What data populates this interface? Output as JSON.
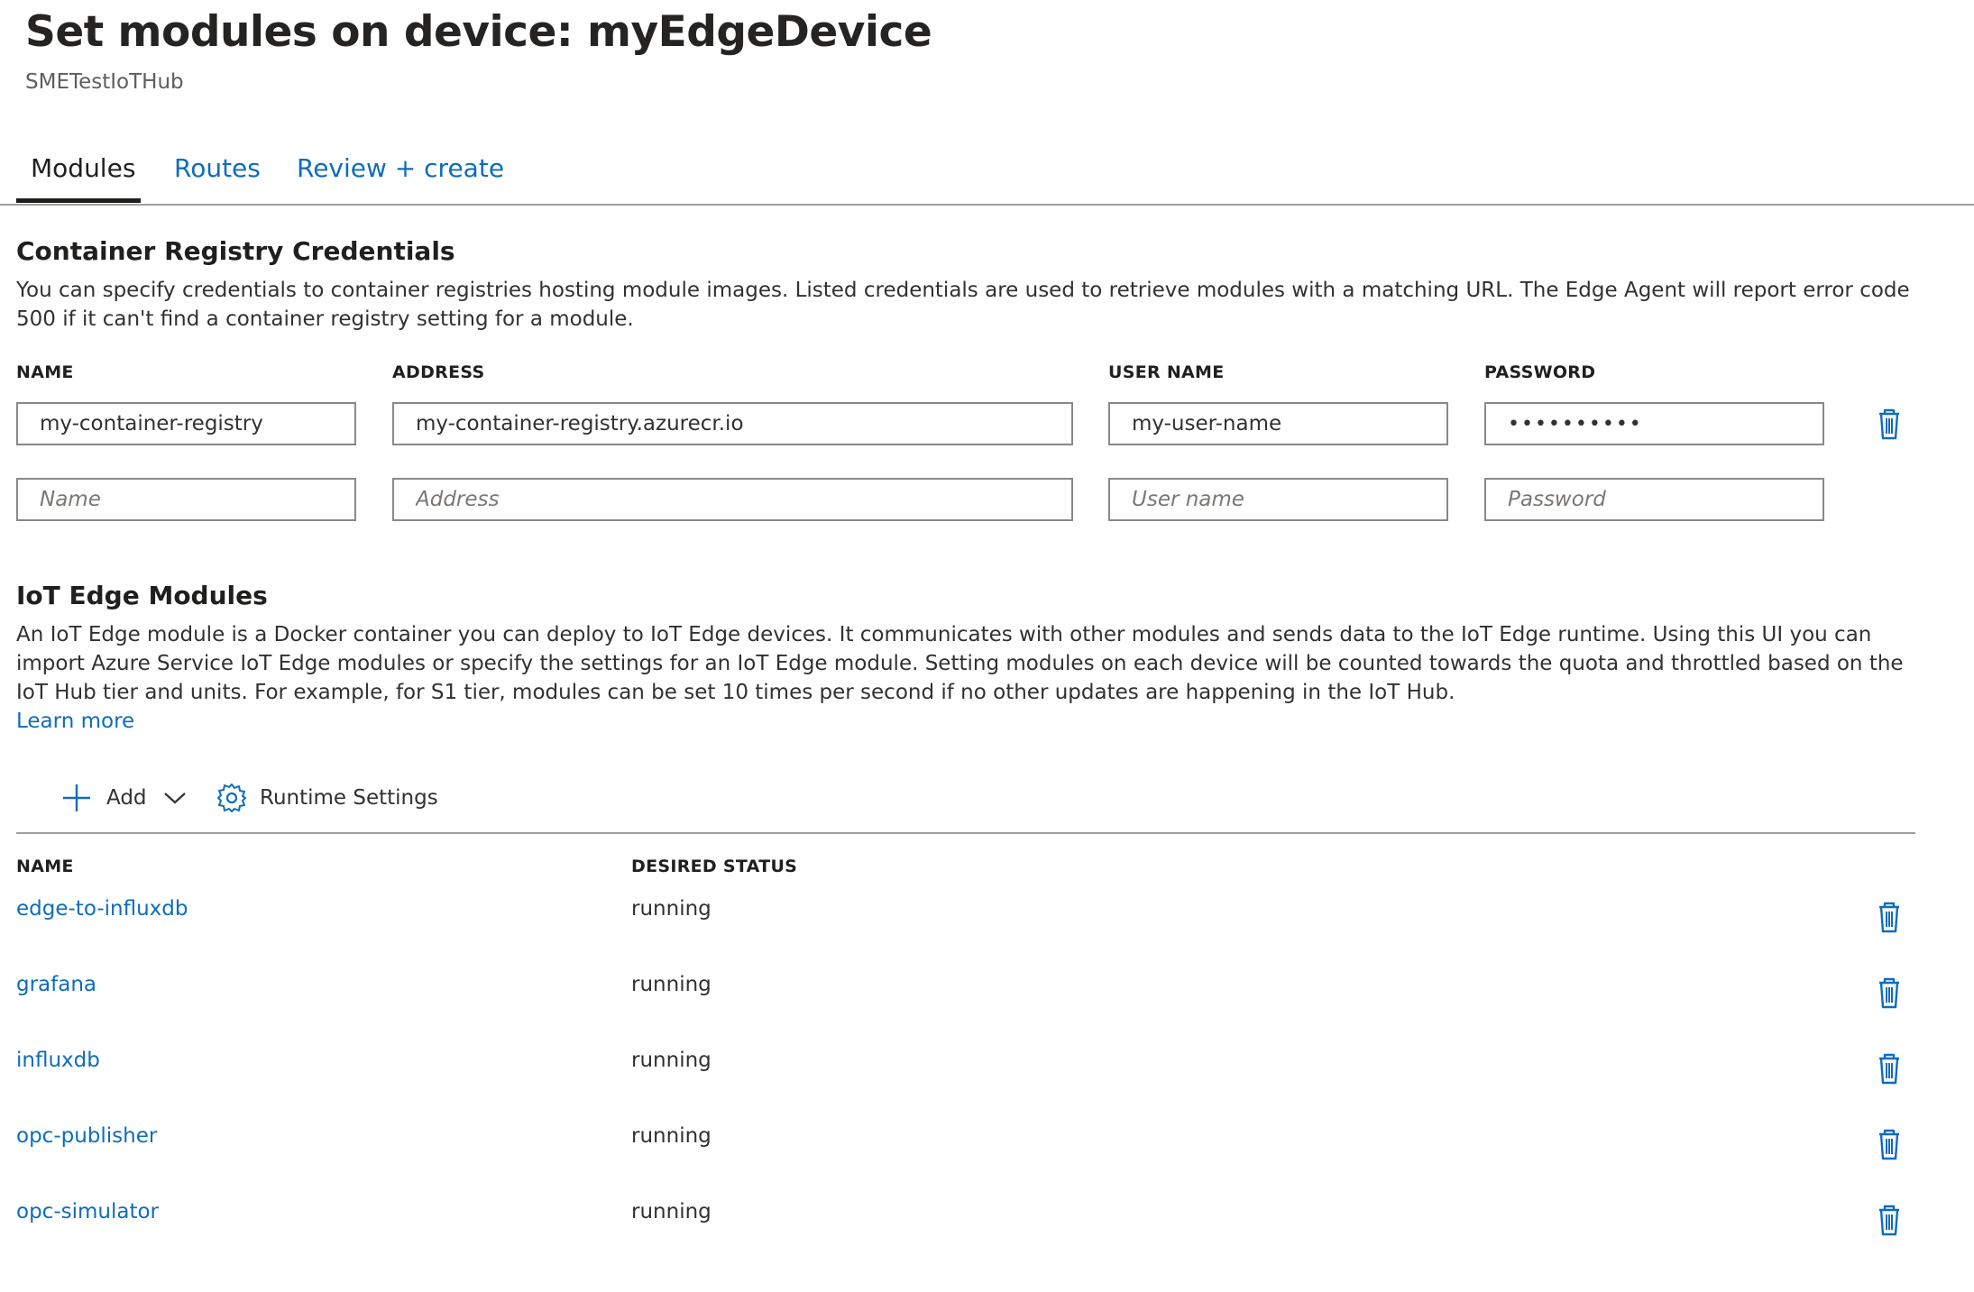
{
  "header": {
    "title": "Set modules on device: myEdgeDevice",
    "subtitle": "SMETestIoTHub"
  },
  "tabs": [
    {
      "label": "Modules",
      "active": true
    },
    {
      "label": "Routes",
      "active": false
    },
    {
      "label": "Review + create",
      "active": false
    }
  ],
  "registry": {
    "title": "Container Registry Credentials",
    "description": "You can specify credentials to container registries hosting module images. Listed credentials are used to retrieve modules with a matching URL. The Edge Agent will report error code 500 if it can't find a container registry setting for a module.",
    "columns": {
      "name": "NAME",
      "address": "ADDRESS",
      "username": "USER NAME",
      "password": "PASSWORD"
    },
    "rows": [
      {
        "name": "my-container-registry",
        "address": "my-container-registry.azurecr.io",
        "username": "my-user-name",
        "password": "••••••••••"
      }
    ],
    "placeholders": {
      "name": "Name",
      "address": "Address",
      "username": "User name",
      "password": "Password"
    }
  },
  "modules": {
    "title": "IoT Edge Modules",
    "description": "An IoT Edge module is a Docker container you can deploy to IoT Edge devices. It communicates with other modules and sends data to the IoT Edge runtime. Using this UI you can import Azure Service IoT Edge modules or specify the settings for an IoT Edge module. Setting modules on each device will be counted towards the quota and throttled based on the IoT Hub tier and units. For example, for S1 tier, modules can be set 10 times per second if no other updates are happening in the IoT Hub.",
    "learn_more": "Learn more",
    "toolbar": {
      "add_label": "Add",
      "runtime_settings_label": "Runtime Settings"
    },
    "columns": {
      "name": "NAME",
      "status": "DESIRED STATUS"
    },
    "rows": [
      {
        "name": "edge-to-influxdb",
        "status": "running"
      },
      {
        "name": "grafana",
        "status": "running"
      },
      {
        "name": "influxdb",
        "status": "running"
      },
      {
        "name": "opc-publisher",
        "status": "running"
      },
      {
        "name": "opc-simulator",
        "status": "running"
      }
    ]
  },
  "icons": {
    "delete": "trash-icon",
    "add": "plus-icon",
    "dropdown": "chevron-down-icon",
    "settings": "gear-icon"
  },
  "colors": {
    "link": "#0f6cbd",
    "text": "#323130",
    "border": "#8a8886"
  }
}
